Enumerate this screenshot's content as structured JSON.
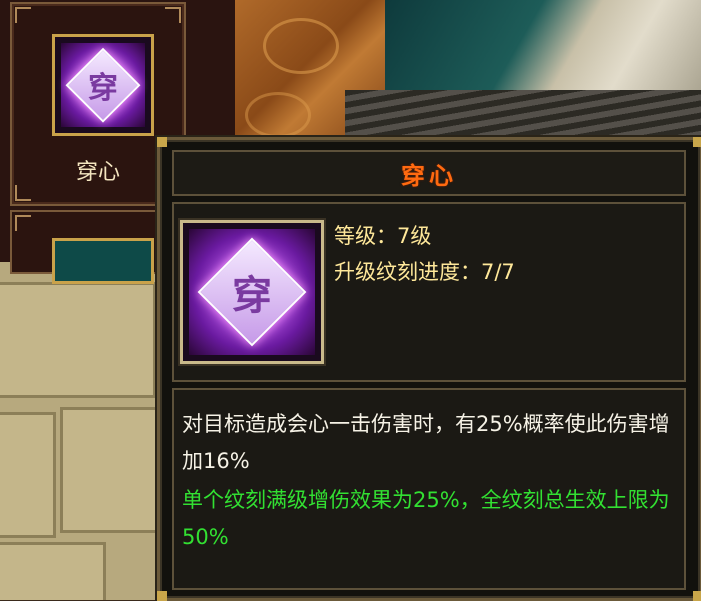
{
  "skill_slot": {
    "label": "穿心",
    "icon": "chuanxin-skill-icon",
    "icon_glyph": "穿"
  },
  "tooltip": {
    "title": "穿心",
    "title_color": "#ff6a10",
    "icon": "chuanxin-skill-icon",
    "icon_glyph": "穿",
    "level_line": "等级：7级",
    "progress_line": "升级纹刻进度：7/7",
    "description": "对目标造成会心一击伤害时，有25%概率使此伤害增加16%",
    "bonus_text": "单个纹刻满级增伤效果为25%，全纹刻总生效上限为50%",
    "bonus_color": "#32e032"
  }
}
